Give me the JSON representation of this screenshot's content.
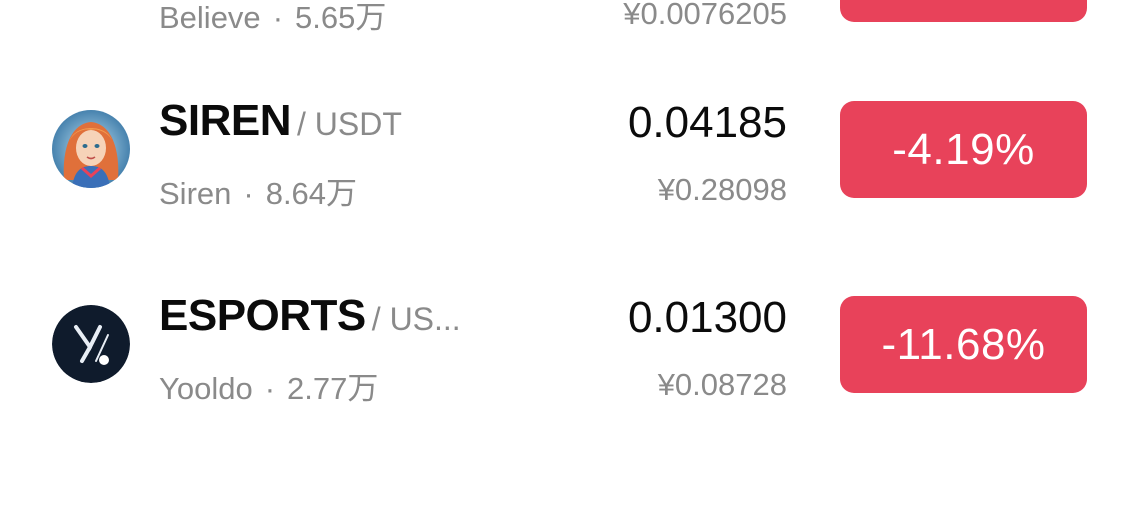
{
  "colors": {
    "down": "#e8425a",
    "muted": "#8a8a8a",
    "text": "#0b0b0b"
  },
  "rows": [
    {
      "symbol": "",
      "quote": "",
      "name": "Believe",
      "volume": "5.65万",
      "price": "",
      "cny": "¥0.0076205",
      "change": "",
      "icon": "believe-logo-icon"
    },
    {
      "symbol": "SIREN",
      "quote": "/ USDT",
      "name": "Siren",
      "volume": "8.64万",
      "price": "0.04185",
      "cny": "¥0.28098",
      "change": "-4.19%",
      "icon": "siren-avatar-icon"
    },
    {
      "symbol": "ESPORTS",
      "quote": "/ US...",
      "name": "Yooldo",
      "volume": "2.77万",
      "price": "0.01300",
      "cny": "¥0.08728",
      "change": "-11.68%",
      "icon": "yooldo-logo-icon"
    }
  ]
}
